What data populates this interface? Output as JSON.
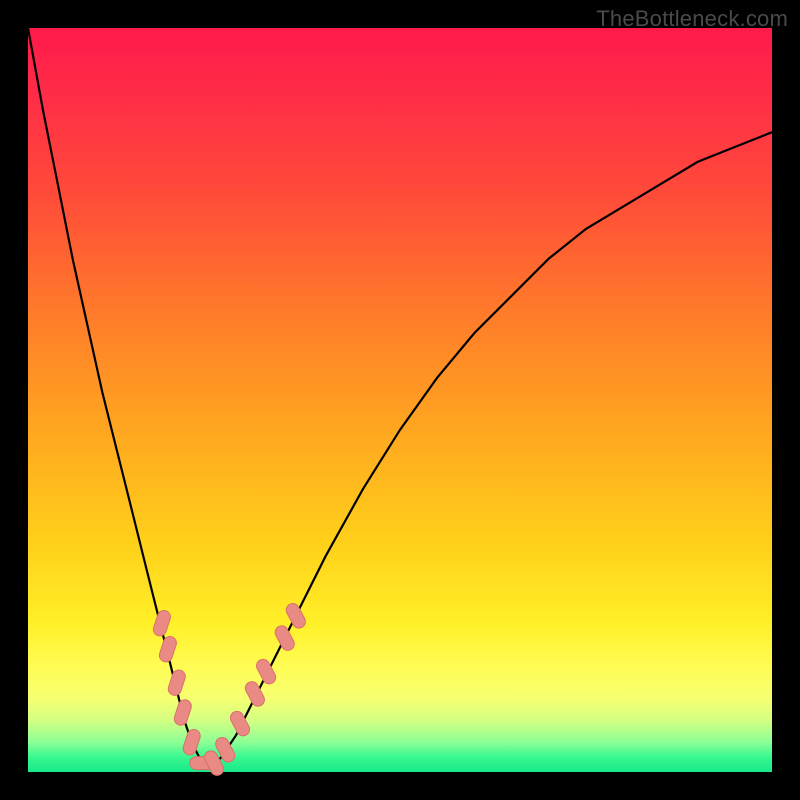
{
  "watermark": "TheBottleneck.com",
  "colors": {
    "frame": "#000000",
    "curve_stroke": "#000000",
    "marker_fill": "#e98a85",
    "marker_stroke": "#d96f6a",
    "gradient_top": "#ff1a4a",
    "gradient_bottom": "#18e88a"
  },
  "chart_data": {
    "type": "line",
    "title": "",
    "xlabel": "",
    "ylabel": "",
    "xlim": [
      0,
      100
    ],
    "ylim": [
      0,
      100
    ],
    "series": [
      {
        "name": "bottleneck-curve",
        "x": [
          0,
          2,
          4,
          6,
          8,
          10,
          12,
          14,
          16,
          18,
          19,
          20,
          21,
          22,
          23,
          24,
          25,
          26,
          28,
          30,
          33,
          36,
          40,
          45,
          50,
          55,
          60,
          65,
          70,
          75,
          80,
          85,
          90,
          95,
          100
        ],
        "y": [
          100,
          89,
          79,
          69,
          60,
          51,
          43,
          35,
          27,
          19,
          15,
          11,
          7,
          4,
          2,
          1,
          1,
          2,
          5,
          9,
          15,
          21,
          29,
          38,
          46,
          53,
          59,
          64,
          69,
          73,
          76,
          79,
          82,
          84,
          86
        ]
      }
    ],
    "markers": [
      {
        "x": 18.0,
        "y": 20.0
      },
      {
        "x": 18.8,
        "y": 16.5
      },
      {
        "x": 20.0,
        "y": 12.0
      },
      {
        "x": 20.8,
        "y": 8.0
      },
      {
        "x": 22.0,
        "y": 4.0
      },
      {
        "x": 23.5,
        "y": 1.2
      },
      {
        "x": 25.0,
        "y": 1.2
      },
      {
        "x": 26.5,
        "y": 3.0
      },
      {
        "x": 28.5,
        "y": 6.5
      },
      {
        "x": 30.5,
        "y": 10.5
      },
      {
        "x": 32.0,
        "y": 13.5
      },
      {
        "x": 34.5,
        "y": 18.0
      },
      {
        "x": 36.0,
        "y": 21.0
      }
    ],
    "notch_x": 24
  }
}
